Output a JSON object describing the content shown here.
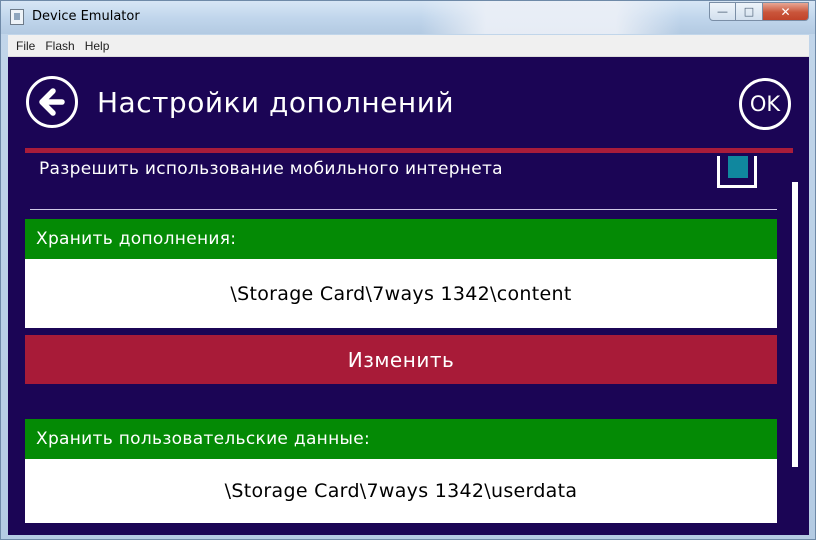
{
  "window": {
    "title": "Device Emulator",
    "caption": {
      "minimize": "—",
      "maximize": "□",
      "close": "✕"
    },
    "menu": [
      "File",
      "Flash",
      "Help"
    ]
  },
  "screen": {
    "title": "Настройки дополнений",
    "ok_label": "OK",
    "mobile_internet_label": "Разрешить использование мобильного интернета",
    "mobile_internet_checked": true,
    "sections": [
      {
        "header": "Хранить дополнения:",
        "path": "\\Storage Card\\7ways 1342\\content"
      },
      {
        "header": "Хранить пользовательские данные:",
        "path": "\\Storage Card\\7ways 1342\\userdata"
      }
    ],
    "change_button_label": "Изменить"
  },
  "colors": {
    "screen_bg": "#1b0555",
    "accent_red": "#a81b38",
    "section_green": "#048a05",
    "checkbox_fill": "#10879e"
  }
}
